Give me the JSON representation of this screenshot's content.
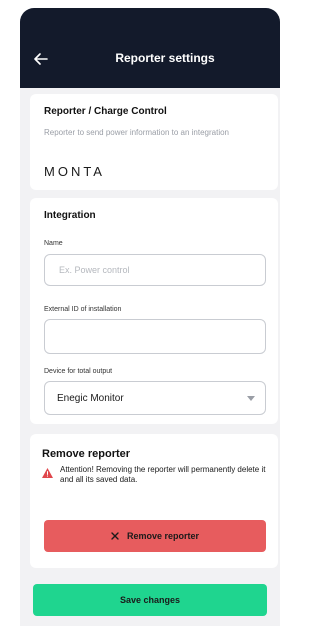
{
  "header": {
    "title": "Reporter settings"
  },
  "reporter": {
    "title": "Reporter / Charge Control",
    "description": "Reporter to send power information to an integration",
    "logo_text": "MONTA"
  },
  "integration": {
    "title": "Integration",
    "name_label": "Name",
    "name_value": "",
    "name_placeholder": "Ex. Power control",
    "external_id_label": "External ID of installation",
    "external_id_value": "",
    "device_label": "Device for total output",
    "device_value": "Enegic Monitor"
  },
  "remove": {
    "title": "Remove reporter",
    "warning": "Attention! Removing the reporter will permanently delete it and all its saved data.",
    "button_label": "Remove reporter"
  },
  "save_label": "Save changes",
  "colors": {
    "header_bg": "#131a2b",
    "danger": "#e75c5e",
    "success": "#1fd58f",
    "warning_icon": "#e0474c"
  },
  "icons": {
    "back": "arrow-left-icon",
    "dropdown": "chevron-down-icon",
    "warning": "warning-triangle-icon",
    "remove": "close-icon"
  }
}
